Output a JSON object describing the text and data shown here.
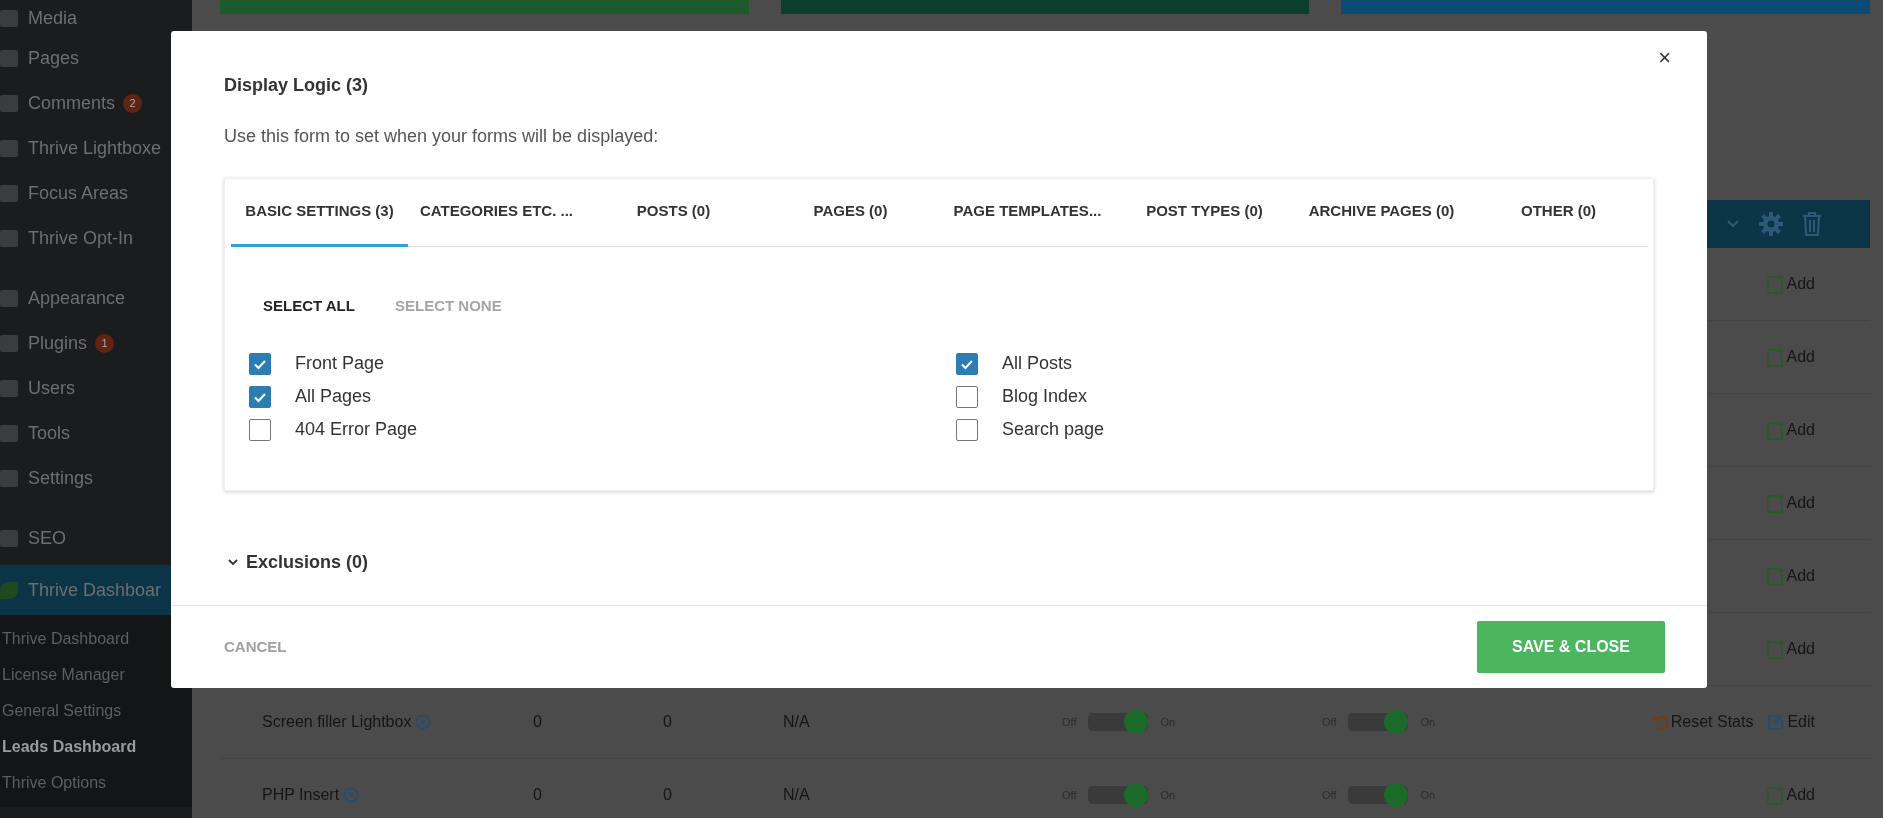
{
  "sidebar": {
    "groups": [
      [
        {
          "label": "Media",
          "selected": false
        },
        {
          "label": "Pages",
          "selected": false
        },
        {
          "label": "Comments",
          "badge": "2",
          "selected": false
        },
        {
          "label": "Thrive Lightboxe",
          "selected": false
        },
        {
          "label": "Focus Areas",
          "selected": false
        },
        {
          "label": "Thrive Opt-In",
          "selected": false
        }
      ],
      [
        {
          "label": "Appearance",
          "selected": false
        },
        {
          "label": "Plugins",
          "badge": "1",
          "selected": false
        },
        {
          "label": "Users",
          "selected": false
        },
        {
          "label": "Tools",
          "selected": false
        },
        {
          "label": "Settings",
          "selected": false
        }
      ],
      [
        {
          "label": "SEO",
          "selected": false
        },
        {
          "label": "Thrive Dashboar",
          "selected": true
        }
      ]
    ],
    "submenu": [
      {
        "label": "Thrive Dashboard",
        "selected": false
      },
      {
        "label": "License Manager",
        "selected": false
      },
      {
        "label": "General Settings",
        "selected": false
      },
      {
        "label": "Leads Dashboard",
        "selected": true
      },
      {
        "label": "Thrive Options",
        "selected": false
      }
    ]
  },
  "top_cards": [
    {
      "color": "#1d5a2b"
    },
    {
      "color": "#0d3e2d"
    },
    {
      "color": "#0b4a72"
    }
  ],
  "rows": [
    {
      "kind": "add",
      "actions": [
        "Add"
      ]
    },
    {
      "kind": "add",
      "actions": [
        "Add"
      ]
    },
    {
      "kind": "add",
      "actions": [
        "Add"
      ]
    },
    {
      "kind": "add",
      "actions": [
        "Add"
      ]
    },
    {
      "kind": "add",
      "actions": [
        "Add"
      ]
    },
    {
      "kind": "add",
      "actions": [
        "Add"
      ]
    },
    {
      "kind": "full",
      "name": "Screen filler Lightbox",
      "column_2": "0",
      "column_3": "0",
      "column_4": "N/A",
      "toggles": [
        {
          "off_label": "Off",
          "on_label": "On",
          "on": true
        },
        {
          "off_label": "Off",
          "on_label": "On",
          "on": true
        }
      ],
      "actions": [
        "Reset Stats",
        "Edit"
      ]
    },
    {
      "kind": "full",
      "name": "PHP Insert",
      "column_2": "0",
      "column_3": "0",
      "column_4": "N/A",
      "toggles": [
        {
          "off_label": "Off",
          "on_label": "On",
          "on": true
        },
        {
          "off_label": "Off",
          "on_label": "On",
          "on": true
        }
      ],
      "actions": [
        "Add"
      ]
    }
  ],
  "modal": {
    "close": "×",
    "title": "Display Logic (3)",
    "description": "Use this form to set when your forms will be displayed:",
    "tabs": [
      {
        "label": "BASIC SETTINGS (3)",
        "selected": true
      },
      {
        "label": "CATEGORIES ETC. ...",
        "selected": false
      },
      {
        "label": "POSTS (0)",
        "selected": false
      },
      {
        "label": "PAGES (0)",
        "selected": false
      },
      {
        "label": "PAGE TEMPLATES...",
        "selected": false
      },
      {
        "label": "POST TYPES (0)",
        "selected": false
      },
      {
        "label": "ARCHIVE PAGES (0)",
        "selected": false
      },
      {
        "label": "OTHER (0)",
        "selected": false
      }
    ],
    "select_buttons": [
      {
        "label": "SELECT ALL",
        "disabled": false
      },
      {
        "label": "SELECT NONE",
        "disabled": true
      }
    ],
    "checkbox_columns": [
      [
        {
          "label": "Front Page",
          "checked": true
        },
        {
          "label": "All Pages",
          "checked": true
        },
        {
          "label": "404 Error Page",
          "checked": false
        }
      ],
      [
        {
          "label": "All Posts",
          "checked": true
        },
        {
          "label": "Blog Index",
          "checked": false
        },
        {
          "label": "Search page",
          "checked": false
        }
      ]
    ],
    "exclusions": {
      "label": "Exclusions (0)",
      "expanded": false
    },
    "cancel": "CANCEL",
    "save": "SAVE & CLOSE"
  }
}
